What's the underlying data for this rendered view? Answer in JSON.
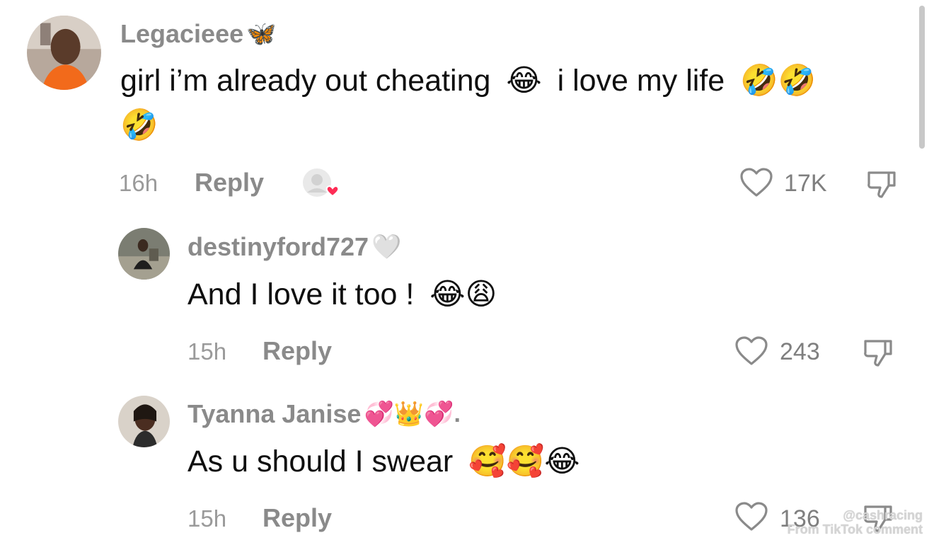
{
  "comments": [
    {
      "username": "Legacieee",
      "username_emoji": "🦋",
      "text_parts": [
        "girl i’m already out cheating",
        "i love my life"
      ],
      "emojis_1": "😂",
      "emojis_2": "🤣🤣",
      "emojis_3": "🤣",
      "time": "16h",
      "reply_label": "Reply",
      "likes": "17K",
      "liked_by_creator": true
    },
    {
      "username": "destinyford727",
      "username_emoji": "🤍",
      "text": "And I love it too !",
      "emojis": "😂😩",
      "time": "15h",
      "reply_label": "Reply",
      "likes": "243"
    },
    {
      "username": "Tyanna Janise",
      "username_emoji": "💞👑💞.",
      "text": "As u should I swear",
      "emojis": "🥰🥰😂",
      "time": "15h",
      "reply_label": "Reply",
      "likes": "136"
    }
  ],
  "watermark": {
    "handle": "@cashracing",
    "caption": "From TikTok comment"
  },
  "colors": {
    "username": "#8a8a8a",
    "meta": "#9a9a9a",
    "heart_accent": "#fe2c55"
  }
}
